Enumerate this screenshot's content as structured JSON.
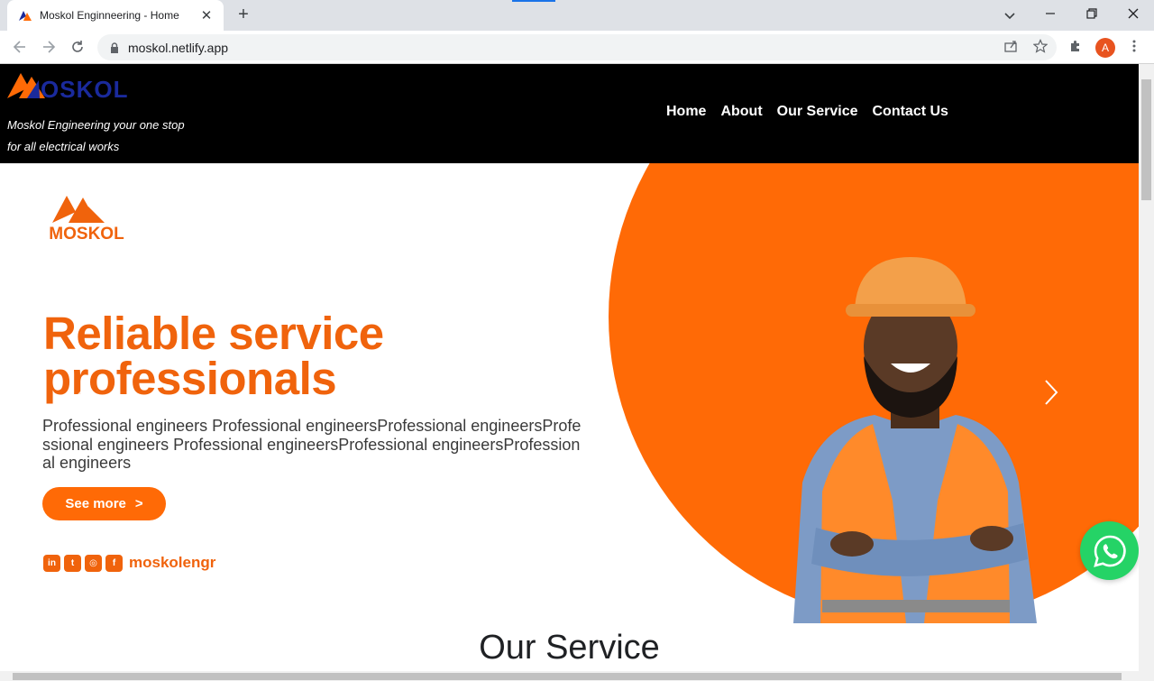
{
  "browser": {
    "tab_title": "Moskol Enginneering - Home",
    "url": "moskol.netlify.app",
    "avatar_letter": "A",
    "icons": [
      "back-icon",
      "forward-icon",
      "reload-icon",
      "lock-icon",
      "share-icon",
      "star-icon",
      "extensions-icon",
      "menu-icon",
      "minimize-icon",
      "restore-icon",
      "close-icon",
      "tab-search-icon",
      "new-tab-icon"
    ]
  },
  "site": {
    "logo_text": "OSKOL",
    "tagline": "Moskol Engineering your one stop for all electrical works",
    "nav": [
      "Home",
      "About",
      "Our Service",
      "Contact Us"
    ]
  },
  "hero": {
    "logo_text": "MOSKOL",
    "headline_line1": "Reliable service",
    "headline_line2": "professionals",
    "body": "Professional engineers Professional engineersProfessional engineersProfessional engineers Professional engineersProfessional engineersProfessional engineers",
    "button_label": "See more",
    "button_arrow": ">",
    "social_handle": "moskolengr",
    "social_icons": [
      "linkedin-icon",
      "twitter-icon",
      "instagram-icon",
      "facebook-icon"
    ],
    "accent_color": "#ff6a06"
  },
  "sections": {
    "our_service_title": "Our Service"
  }
}
